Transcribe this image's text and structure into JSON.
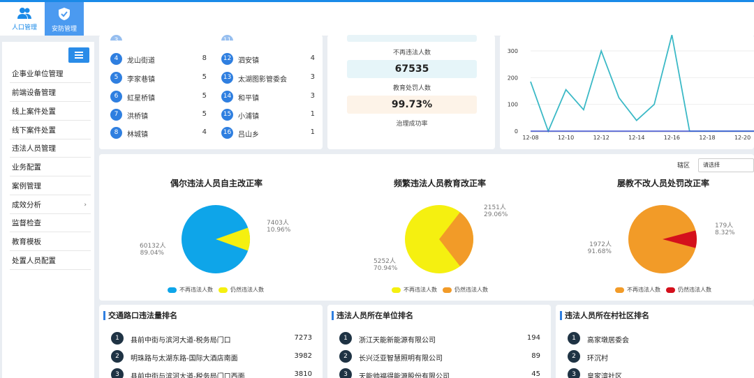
{
  "top_tabs": [
    {
      "label": "人口管理",
      "icon": "people-icon",
      "active": false
    },
    {
      "label": "安防管理",
      "icon": "shield-icon",
      "active": true
    }
  ],
  "sidebar": {
    "items": [
      {
        "label": "企事业单位管理"
      },
      {
        "label": "前端设备管理"
      },
      {
        "label": "线上案件处置"
      },
      {
        "label": "线下案件处置"
      },
      {
        "label": "违法人员管理"
      },
      {
        "label": "业务配置"
      },
      {
        "label": "案例管理"
      },
      {
        "label": "成效分析",
        "arrow": "›"
      },
      {
        "label": "监督检查"
      },
      {
        "label": "教育模板"
      },
      {
        "label": "处置人员配置"
      }
    ]
  },
  "town_list": {
    "left": [
      {
        "num": "4",
        "name": "龙山街道",
        "count": "8"
      },
      {
        "num": "5",
        "name": "李家巷镇",
        "count": "5"
      },
      {
        "num": "6",
        "name": "虹星桥镇",
        "count": "5"
      },
      {
        "num": "7",
        "name": "洪桥镇",
        "count": "5"
      },
      {
        "num": "8",
        "name": "林城镇",
        "count": "4"
      }
    ],
    "right": [
      {
        "num": "12",
        "name": "泗安镇",
        "count": "4"
      },
      {
        "num": "13",
        "name": "太湖图影管委会",
        "count": "3"
      },
      {
        "num": "14",
        "name": "和平镇",
        "count": "3"
      },
      {
        "num": "15",
        "name": "小浦镇",
        "count": "1"
      },
      {
        "num": "16",
        "name": "吕山乡",
        "count": "1"
      }
    ]
  },
  "stats": {
    "label1": "不再违法人数",
    "value2": "67535",
    "label2": "教育处罚人数",
    "value3": "99.73%",
    "label3": "治理成功率"
  },
  "line_chart": {
    "y_ticks": [
      "300",
      "200",
      "100",
      "0"
    ],
    "x_ticks": [
      "12-08",
      "12-10",
      "12-12",
      "12-14",
      "12-16",
      "12-18",
      "12-20"
    ]
  },
  "filter": {
    "label": "辖区",
    "value": "请选择"
  },
  "pies": [
    {
      "title": "偶尔违法人员自主改正率",
      "big_label": "60132人",
      "big_pct": "89.04%",
      "small_label": "7403人",
      "small_pct": "10.96%",
      "legend_a": "不再违法人数",
      "legend_b": "仍然违法人数",
      "color_big": "#0ea5e9",
      "color_small": "#f5f010"
    },
    {
      "title": "频繁违法人员教育改正率",
      "big_label": "5252人",
      "big_pct": "70.94%",
      "small_label": "2151人",
      "small_pct": "29.06%",
      "legend_a": "不再违法人数",
      "legend_b": "仍然违法人数",
      "color_big": "#f5f010",
      "color_small": "#f29b28"
    },
    {
      "title": "屡教不改人员处罚改正率",
      "big_label": "1972人",
      "big_pct": "91.68%",
      "small_label": "179人",
      "small_pct": "8.32%",
      "legend_a": "不再违法人数",
      "legend_b": "仍然违法人数",
      "color_big": "#f29b28",
      "color_small": "#d4101c"
    }
  ],
  "chart_data": [
    {
      "type": "pie",
      "title": "偶尔违法人员自主改正率",
      "labels": [
        "不再违法人数",
        "仍然违法人数"
      ],
      "values": [
        60132,
        7403
      ],
      "percents": [
        89.04,
        10.96
      ]
    },
    {
      "type": "pie",
      "title": "频繁违法人员教育改正率",
      "labels": [
        "不再违法人数",
        "仍然违法人数"
      ],
      "values": [
        5252,
        2151
      ],
      "percents": [
        70.94,
        29.06
      ]
    },
    {
      "type": "pie",
      "title": "屡教不改人员处罚改正率",
      "labels": [
        "不再违法人数",
        "仍然违法人数"
      ],
      "values": [
        1972,
        179
      ],
      "percents": [
        91.68,
        8.32
      ]
    },
    {
      "type": "line",
      "x": [
        "12-08",
        "12-09",
        "12-10",
        "12-11",
        "12-12",
        "12-13",
        "12-14",
        "12-15",
        "12-16",
        "12-17",
        "12-18",
        "12-19",
        "12-20",
        "12-21"
      ],
      "series": [
        {
          "color": "#3bb9c6",
          "values": [
            185,
            0,
            155,
            80,
            300,
            125,
            40,
            100,
            360,
            0,
            0,
            0,
            0,
            0
          ]
        },
        {
          "color": "#3f51d6",
          "values": [
            0,
            0,
            0,
            0,
            0,
            0,
            0,
            0,
            0,
            0,
            0,
            0,
            0,
            0
          ]
        }
      ],
      "ylim": [
        0,
        330
      ]
    }
  ],
  "rankings": [
    {
      "title": "交通路口违法量排名",
      "rows": [
        {
          "num": "1",
          "name": "县前中街与滨河大道-税务局门口",
          "count": "7273"
        },
        {
          "num": "2",
          "name": "明珠路与太湖东路-国际大酒店南面",
          "count": "3982"
        },
        {
          "num": "3",
          "name": "县前中街与滨河大道-税务局门口西面",
          "count": "3810"
        }
      ]
    },
    {
      "title": "违法人员所在单位排名",
      "rows": [
        {
          "num": "1",
          "name": "浙江天能新能源有限公司",
          "count": "194"
        },
        {
          "num": "2",
          "name": "长兴泛亚智慧照明有限公司",
          "count": "89"
        },
        {
          "num": "3",
          "name": "天能帅福得能源股份有限公司",
          "count": "45"
        }
      ]
    },
    {
      "title": "违法人员所在村社区排名",
      "rows": [
        {
          "num": "1",
          "name": "高家墩居委会",
          "count": ""
        },
        {
          "num": "2",
          "name": "环沉村",
          "count": ""
        },
        {
          "num": "3",
          "name": "皇家湾社区",
          "count": ""
        }
      ]
    }
  ]
}
